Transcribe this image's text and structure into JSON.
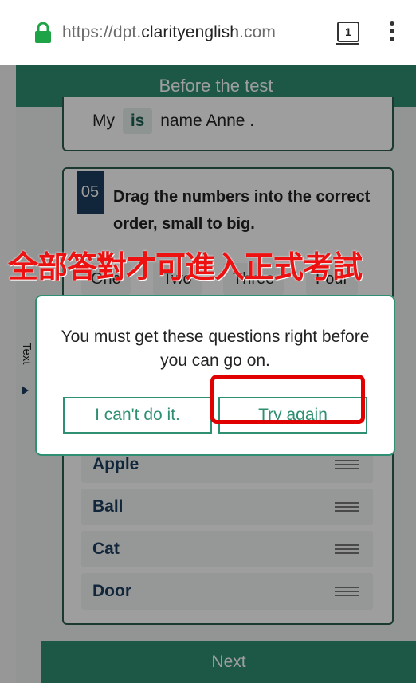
{
  "browser": {
    "url_prefix": "https://dpt.",
    "url_domain": "clarityenglish",
    "url_suffix": ".com",
    "tab_count": "1"
  },
  "app": {
    "header_title": "Before the test",
    "sentence": {
      "before": "My",
      "chip": "is",
      "after": "name Anne ."
    },
    "question": {
      "number": "05",
      "prompt": "Drag the numbers into the correct order, small to big."
    },
    "choices": [
      "One",
      "Two",
      "Three",
      "Four"
    ],
    "answer_rows": [
      "Apple",
      "Ball",
      "Cat",
      "Door"
    ],
    "side_tab_label": "Text",
    "next_label": "Next"
  },
  "overlay_caption": "全部答對才可進入正式考試",
  "dialog": {
    "message": "You must get these questions right before you can go on.",
    "cant_label": "I can't do it.",
    "try_label": "Try again"
  },
  "colors": {
    "accent": "#2f8f73",
    "question_badge": "#1e3e5f",
    "highlight": "#e00000",
    "caption": "#ee1111"
  }
}
